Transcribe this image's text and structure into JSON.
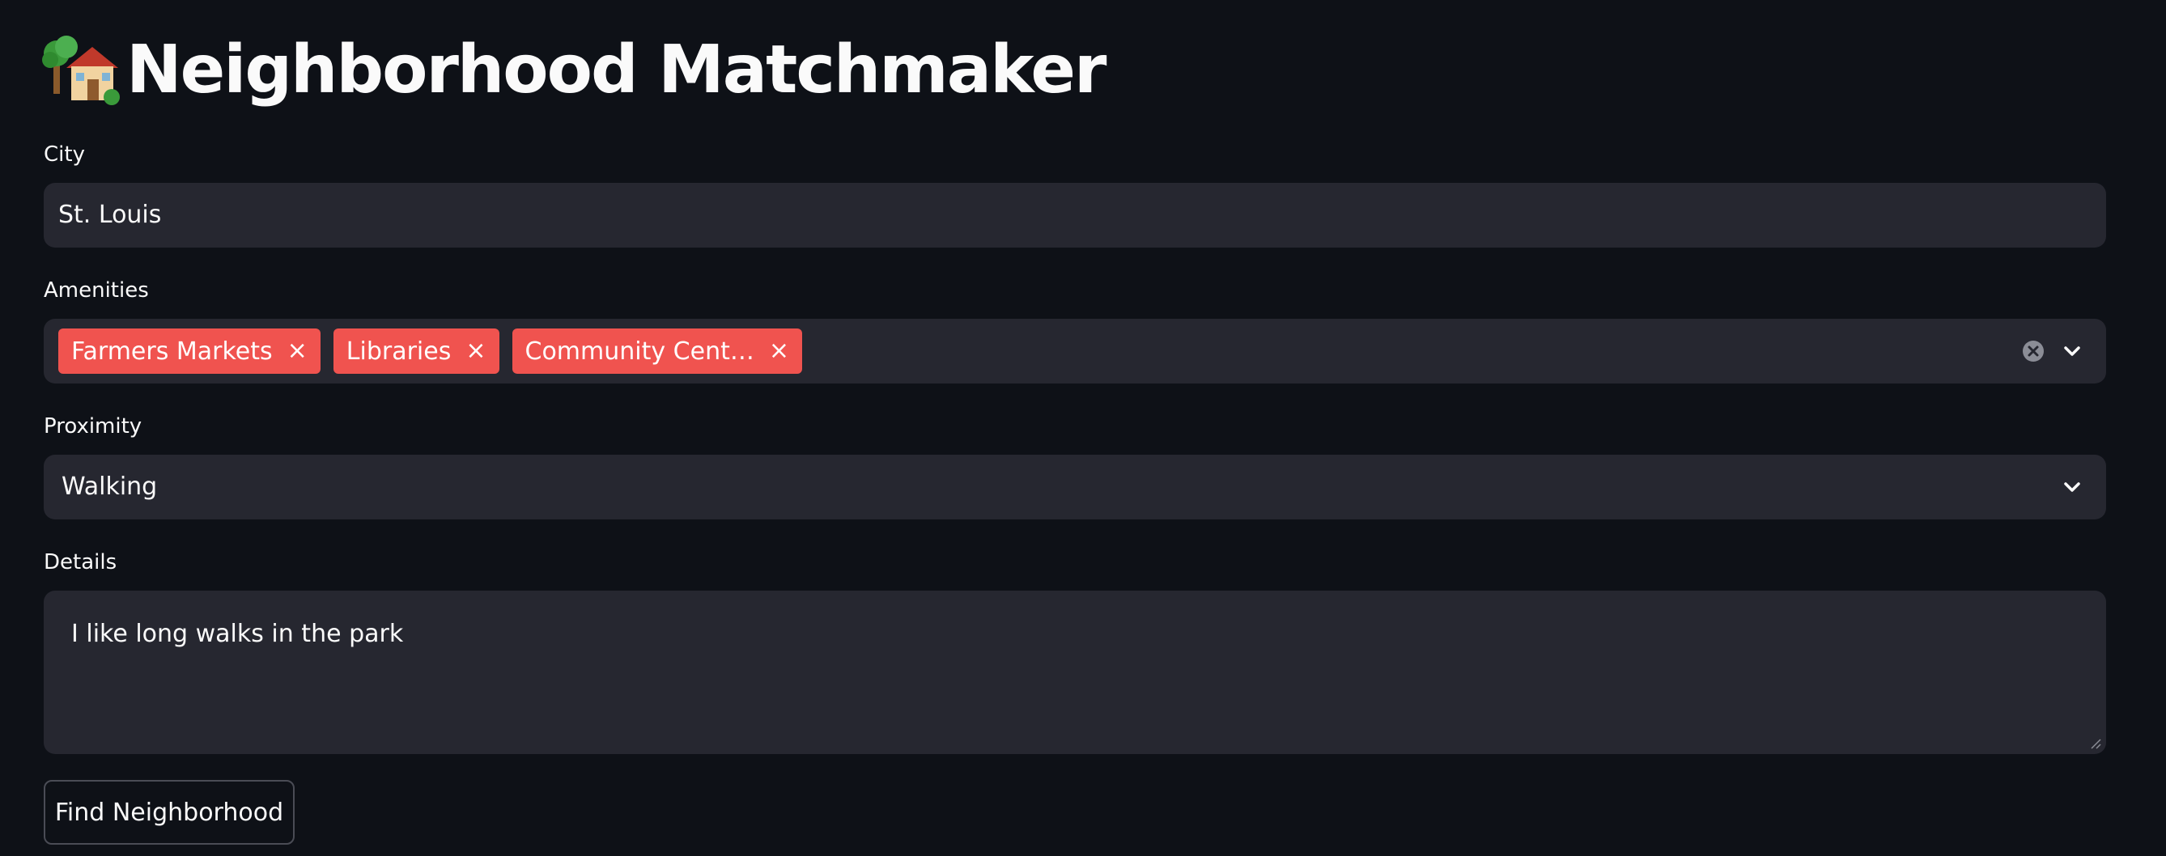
{
  "header": {
    "title": "Neighborhood Matchmaker",
    "icon": "house-with-garden-icon"
  },
  "city": {
    "label": "City",
    "value": "St. Louis"
  },
  "amenities": {
    "label": "Amenities",
    "tags": [
      {
        "label": "Farmers Markets",
        "remove": "×"
      },
      {
        "label": "Libraries",
        "remove": "×"
      },
      {
        "label": "Community Cent…",
        "remove": "×"
      }
    ],
    "tag_color": "#f0534f"
  },
  "proximity": {
    "label": "Proximity",
    "selected": "Walking"
  },
  "details": {
    "label": "Details",
    "value": "I like long walks in the park"
  },
  "actions": {
    "find_label": "Find Neighborhood"
  },
  "colors": {
    "background": "#0e1117",
    "field": "#262730",
    "accent": "#f0534f",
    "text": "#fafafa"
  }
}
